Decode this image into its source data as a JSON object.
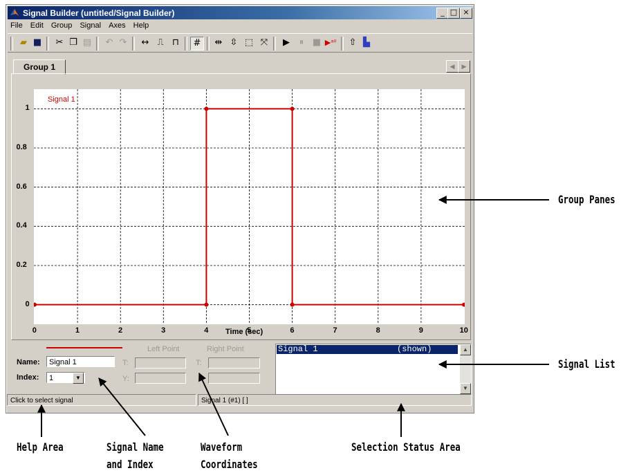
{
  "window": {
    "title": "Signal Builder (untitled/Signal Builder)",
    "buttons": [
      "_",
      "□",
      "×"
    ]
  },
  "menu": [
    "File",
    "Edit",
    "Group",
    "Signal",
    "Axes",
    "Help"
  ],
  "toolbar": {
    "icons": [
      "open-icon",
      "save-icon",
      "cut-icon",
      "copy-icon",
      "paste-icon",
      "undo-icon",
      "redo-icon",
      "constant-icon",
      "step-icon",
      "pulse-icon",
      "grid-icon",
      "fit-time-icon",
      "fit-value-icon",
      "zoom-box-icon",
      "zoom-out-icon",
      "start-icon",
      "pause-icon",
      "stop-icon",
      "run-all-icon",
      "up-icon",
      "show-block-icon"
    ]
  },
  "tabs": {
    "active": "Group 1"
  },
  "chart_data": {
    "type": "line",
    "series": [
      {
        "name": "Signal 1",
        "color": "#cc0000",
        "x": [
          0,
          4,
          4,
          6,
          6,
          10
        ],
        "y": [
          0,
          0,
          1,
          1,
          0,
          0
        ]
      }
    ],
    "xlim": [
      0,
      10
    ],
    "ylim": [
      -0.1,
      1.1
    ],
    "xticks": [
      "0",
      "1",
      "2",
      "3",
      "4",
      "5",
      "6",
      "7",
      "8",
      "9",
      "10"
    ],
    "yticks": [
      "0",
      "0.2",
      "0.4",
      "0.6",
      "0.8",
      "1"
    ],
    "xlabel": "Time (sec)",
    "ylabel": "",
    "grid": true,
    "legend": "top-left"
  },
  "editor": {
    "left_point": "Left Point",
    "right_point": "Right Point",
    "name_label": "Name:",
    "name_value": "Signal 1",
    "index_label": "Index:",
    "index_value": "1",
    "t_label": "T:",
    "y_label": "Y:"
  },
  "signal_list": {
    "items": [
      {
        "name": "Signal 1",
        "state": "(shown)"
      }
    ]
  },
  "status": {
    "help": "Click to select signal",
    "selection": "Signal 1 (#1) [ ]"
  },
  "callouts": {
    "group_panes": "Group Panes",
    "signal_list": "Signal List",
    "help_area": "Help Area",
    "signal_name_1": "Signal Name",
    "signal_name_2": "and Index",
    "waveform_1": "Waveform",
    "waveform_2": "Coordinates",
    "selection_status": "Selection Status Area"
  }
}
